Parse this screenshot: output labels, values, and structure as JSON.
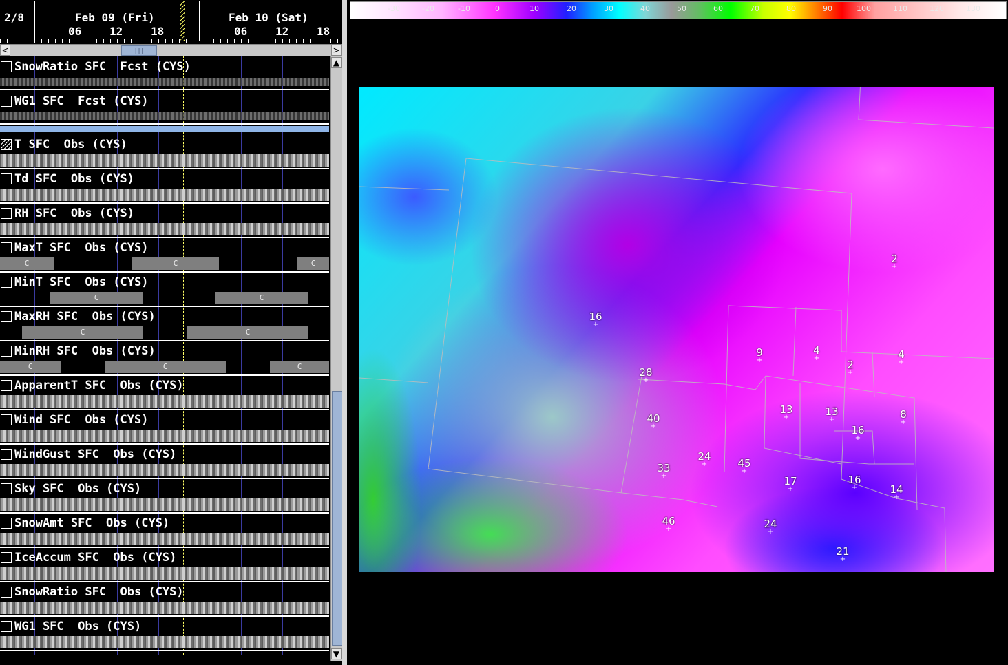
{
  "timeline": {
    "first_date": "2/8",
    "days": [
      "Feb 09 (Fri)",
      "Feb 10 (Sat)"
    ],
    "hours_day1": [
      "06",
      "12",
      "18"
    ],
    "hours_day2": [
      "06",
      "12",
      "18"
    ]
  },
  "scroll_arrows": {
    "left": "<",
    "right": ">",
    "thumb": "|||"
  },
  "rows_top": [
    {
      "label": "SnowRatio SFC  Fcst (CYS)"
    },
    {
      "label": "WG1 SFC  Fcst (CYS)"
    }
  ],
  "rows_obs": [
    {
      "label": "T SFC  Obs (CYS)",
      "checked": true
    },
    {
      "label": "Td SFC  Obs (CYS)"
    },
    {
      "label": "RH SFC  Obs (CYS)"
    },
    {
      "label": "MaxT SFC  Obs (CYS)",
      "bar_label": "C"
    },
    {
      "label": "MinT SFC  Obs (CYS)",
      "bar_label": "C"
    },
    {
      "label": "MaxRH SFC  Obs (CYS)",
      "bar_label": "C"
    },
    {
      "label": "MinRH SFC  Obs (CYS)",
      "bar_label": "C"
    },
    {
      "label": "ApparentT SFC  Obs (CYS)"
    },
    {
      "label": "Wind SFC  Obs (CYS)"
    },
    {
      "label": "WindGust SFC  Obs (CYS)"
    },
    {
      "label": "Sky SFC  Obs (CYS)"
    },
    {
      "label": "SnowAmt SFC  Obs (CYS)"
    },
    {
      "label": "IceAccum SFC  Obs (CYS)"
    },
    {
      "label": "SnowRatio SFC  Obs (CYS)"
    },
    {
      "label": "WG1 SFC  Obs (CYS)"
    }
  ],
  "colorbar": {
    "ticks": [
      "-30",
      "-20",
      "-10",
      "0",
      "10",
      "20",
      "30",
      "40",
      "50",
      "60",
      "70",
      "80",
      "90",
      "100",
      "110",
      "120",
      "130"
    ]
  },
  "station_values": [
    "2",
    "16",
    "9",
    "4",
    "2",
    "4",
    "28",
    "13",
    "13",
    "8",
    "16",
    "40",
    "24",
    "45",
    "33",
    "17",
    "16",
    "14",
    "46",
    "24",
    "21"
  ]
}
